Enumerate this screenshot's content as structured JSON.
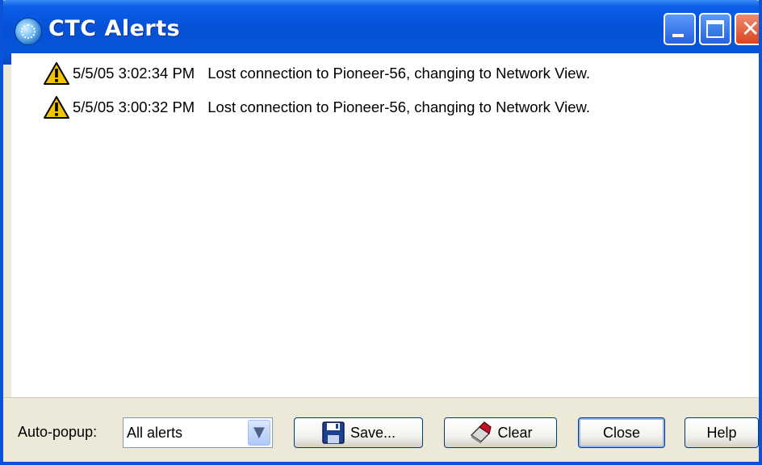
{
  "window": {
    "title": "CTC Alerts",
    "accent_color": "#0a53d8"
  },
  "alerts": [
    {
      "icon": "warning-icon",
      "time": "5/5/05 3:02:34 PM",
      "message": "Lost connection to Pioneer-56, changing to Network View."
    },
    {
      "icon": "warning-icon",
      "time": "5/5/05 3:00:32 PM",
      "message": "Lost connection to Pioneer-56, changing to Network View."
    }
  ],
  "footer": {
    "auto_popup_label": "Auto-popup:",
    "auto_popup_value": "All alerts",
    "save_label": "Save...",
    "clear_label": "Clear",
    "close_label": "Close",
    "help_label": "Help"
  }
}
